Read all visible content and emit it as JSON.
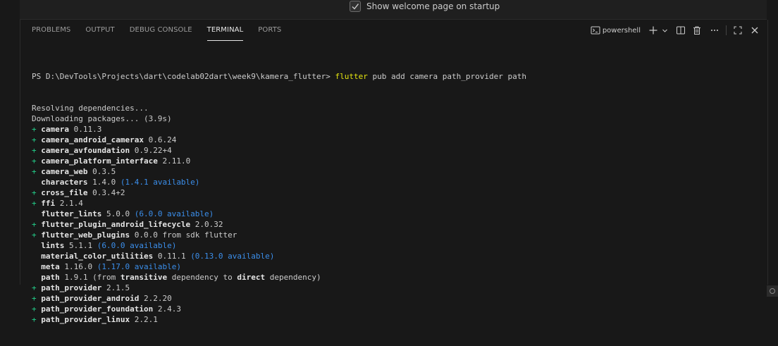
{
  "welcome": {
    "checkbox_checked": true,
    "label": "Show welcome page on startup"
  },
  "panel": {
    "tabs": [
      {
        "label": "PROBLEMS",
        "active": false
      },
      {
        "label": "OUTPUT",
        "active": false
      },
      {
        "label": "DEBUG CONSOLE",
        "active": false
      },
      {
        "label": "TERMINAL",
        "active": true
      },
      {
        "label": "PORTS",
        "active": false
      }
    ],
    "shell_label": "powershell",
    "action_icons": [
      "terminal-icon",
      "plus-icon",
      "chevron-down-icon",
      "split-icon",
      "trash-icon",
      "more-icon",
      "maximize-icon",
      "close-icon"
    ]
  },
  "terminal": {
    "prompt": "PS D:\\DevTools\\Projects\\dart\\codelab02dart\\week9\\kamera_flutter> ",
    "command": "flutter",
    "args": " pub add camera path_provider path",
    "lines": [
      {
        "text": "Resolving dependencies..."
      },
      {
        "text": "Downloading packages... (3.9s)"
      },
      {
        "prefix": "+ ",
        "pkg": "camera",
        "ver": " 0.11.3"
      },
      {
        "prefix": "+ ",
        "pkg": "camera_android_camerax",
        "ver": " 0.6.24"
      },
      {
        "prefix": "+ ",
        "pkg": "camera_avfoundation",
        "ver": " 0.9.22+4"
      },
      {
        "prefix": "+ ",
        "pkg": "camera_platform_interface",
        "ver": " 2.11.0"
      },
      {
        "prefix": "+ ",
        "pkg": "camera_web",
        "ver": " 0.3.5"
      },
      {
        "prefix": "  ",
        "pkg": "characters",
        "ver": " 1.4.0 ",
        "avail": "(1.4.1 available)"
      },
      {
        "prefix": "+ ",
        "pkg": "cross_file",
        "ver": " 0.3.4+2"
      },
      {
        "prefix": "+ ",
        "pkg": "ffi",
        "ver": " 2.1.4"
      },
      {
        "prefix": "  ",
        "pkg": "flutter_lints",
        "ver": " 5.0.0 ",
        "avail": "(6.0.0 available)"
      },
      {
        "prefix": "+ ",
        "pkg": "flutter_plugin_android_lifecycle",
        "ver": " 2.0.32"
      },
      {
        "prefix": "+ ",
        "pkg": "flutter_web_plugins",
        "ver": " 0.0.0 from sdk flutter"
      },
      {
        "prefix": "  ",
        "pkg": "lints",
        "ver": " 5.1.1 ",
        "avail": "(6.0.0 available)"
      },
      {
        "prefix": "  ",
        "pkg": "material_color_utilities",
        "ver": " 0.11.1 ",
        "avail": "(0.13.0 available)"
      },
      {
        "prefix": "  ",
        "pkg": "meta",
        "ver": " 1.16.0 ",
        "avail": "(1.17.0 available)"
      },
      {
        "prefix": "  ",
        "pkg": "path",
        "ver": " 1.9.1 (from ",
        "b1": "transitive",
        "mid": " dependency to ",
        "b2": "direct",
        "tail": " dependency)"
      },
      {
        "prefix": "+ ",
        "pkg": "path_provider",
        "ver": " 2.1.5"
      },
      {
        "prefix": "+ ",
        "pkg": "path_provider_android",
        "ver": " 2.2.20"
      },
      {
        "prefix": "+ ",
        "pkg": "path_provider_foundation",
        "ver": " 2.4.3"
      },
      {
        "prefix": "+ ",
        "pkg": "path_provider_linux",
        "ver": " 2.2.1"
      }
    ]
  },
  "colors": {
    "background": "#181818",
    "added": "#23d18b",
    "available": "#3b8eea",
    "command": "#e5e510"
  }
}
